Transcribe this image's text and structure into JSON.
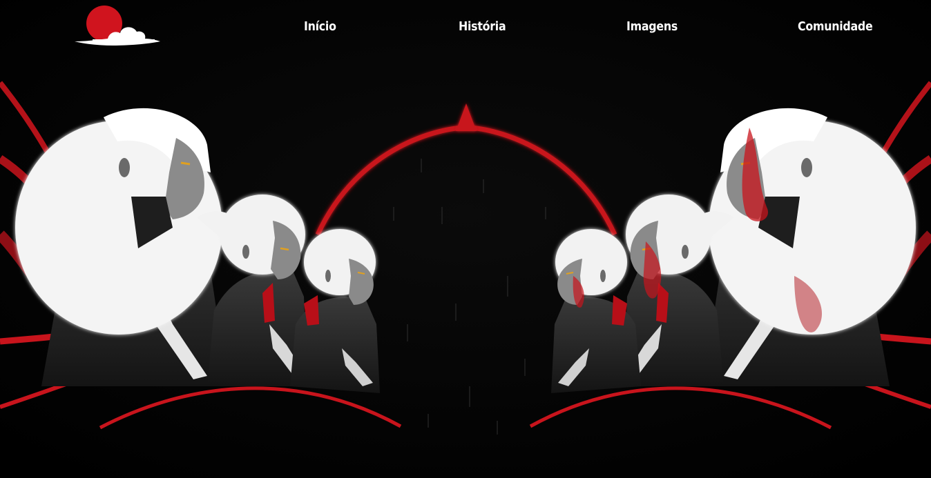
{
  "brand": {
    "logo_icon": "red-moon-cloud-icon",
    "moon_color": "#d0141e",
    "cloud_color": "#ffffff"
  },
  "nav": {
    "items": [
      {
        "label": "Início"
      },
      {
        "label": "História"
      },
      {
        "label": "Imagens"
      },
      {
        "label": "Comunidade"
      }
    ]
  },
  "hero": {
    "image": "hero-artwork-mirrored-white-haired-figures",
    "accent_color": "#d0141e",
    "background_color": "#000000"
  }
}
